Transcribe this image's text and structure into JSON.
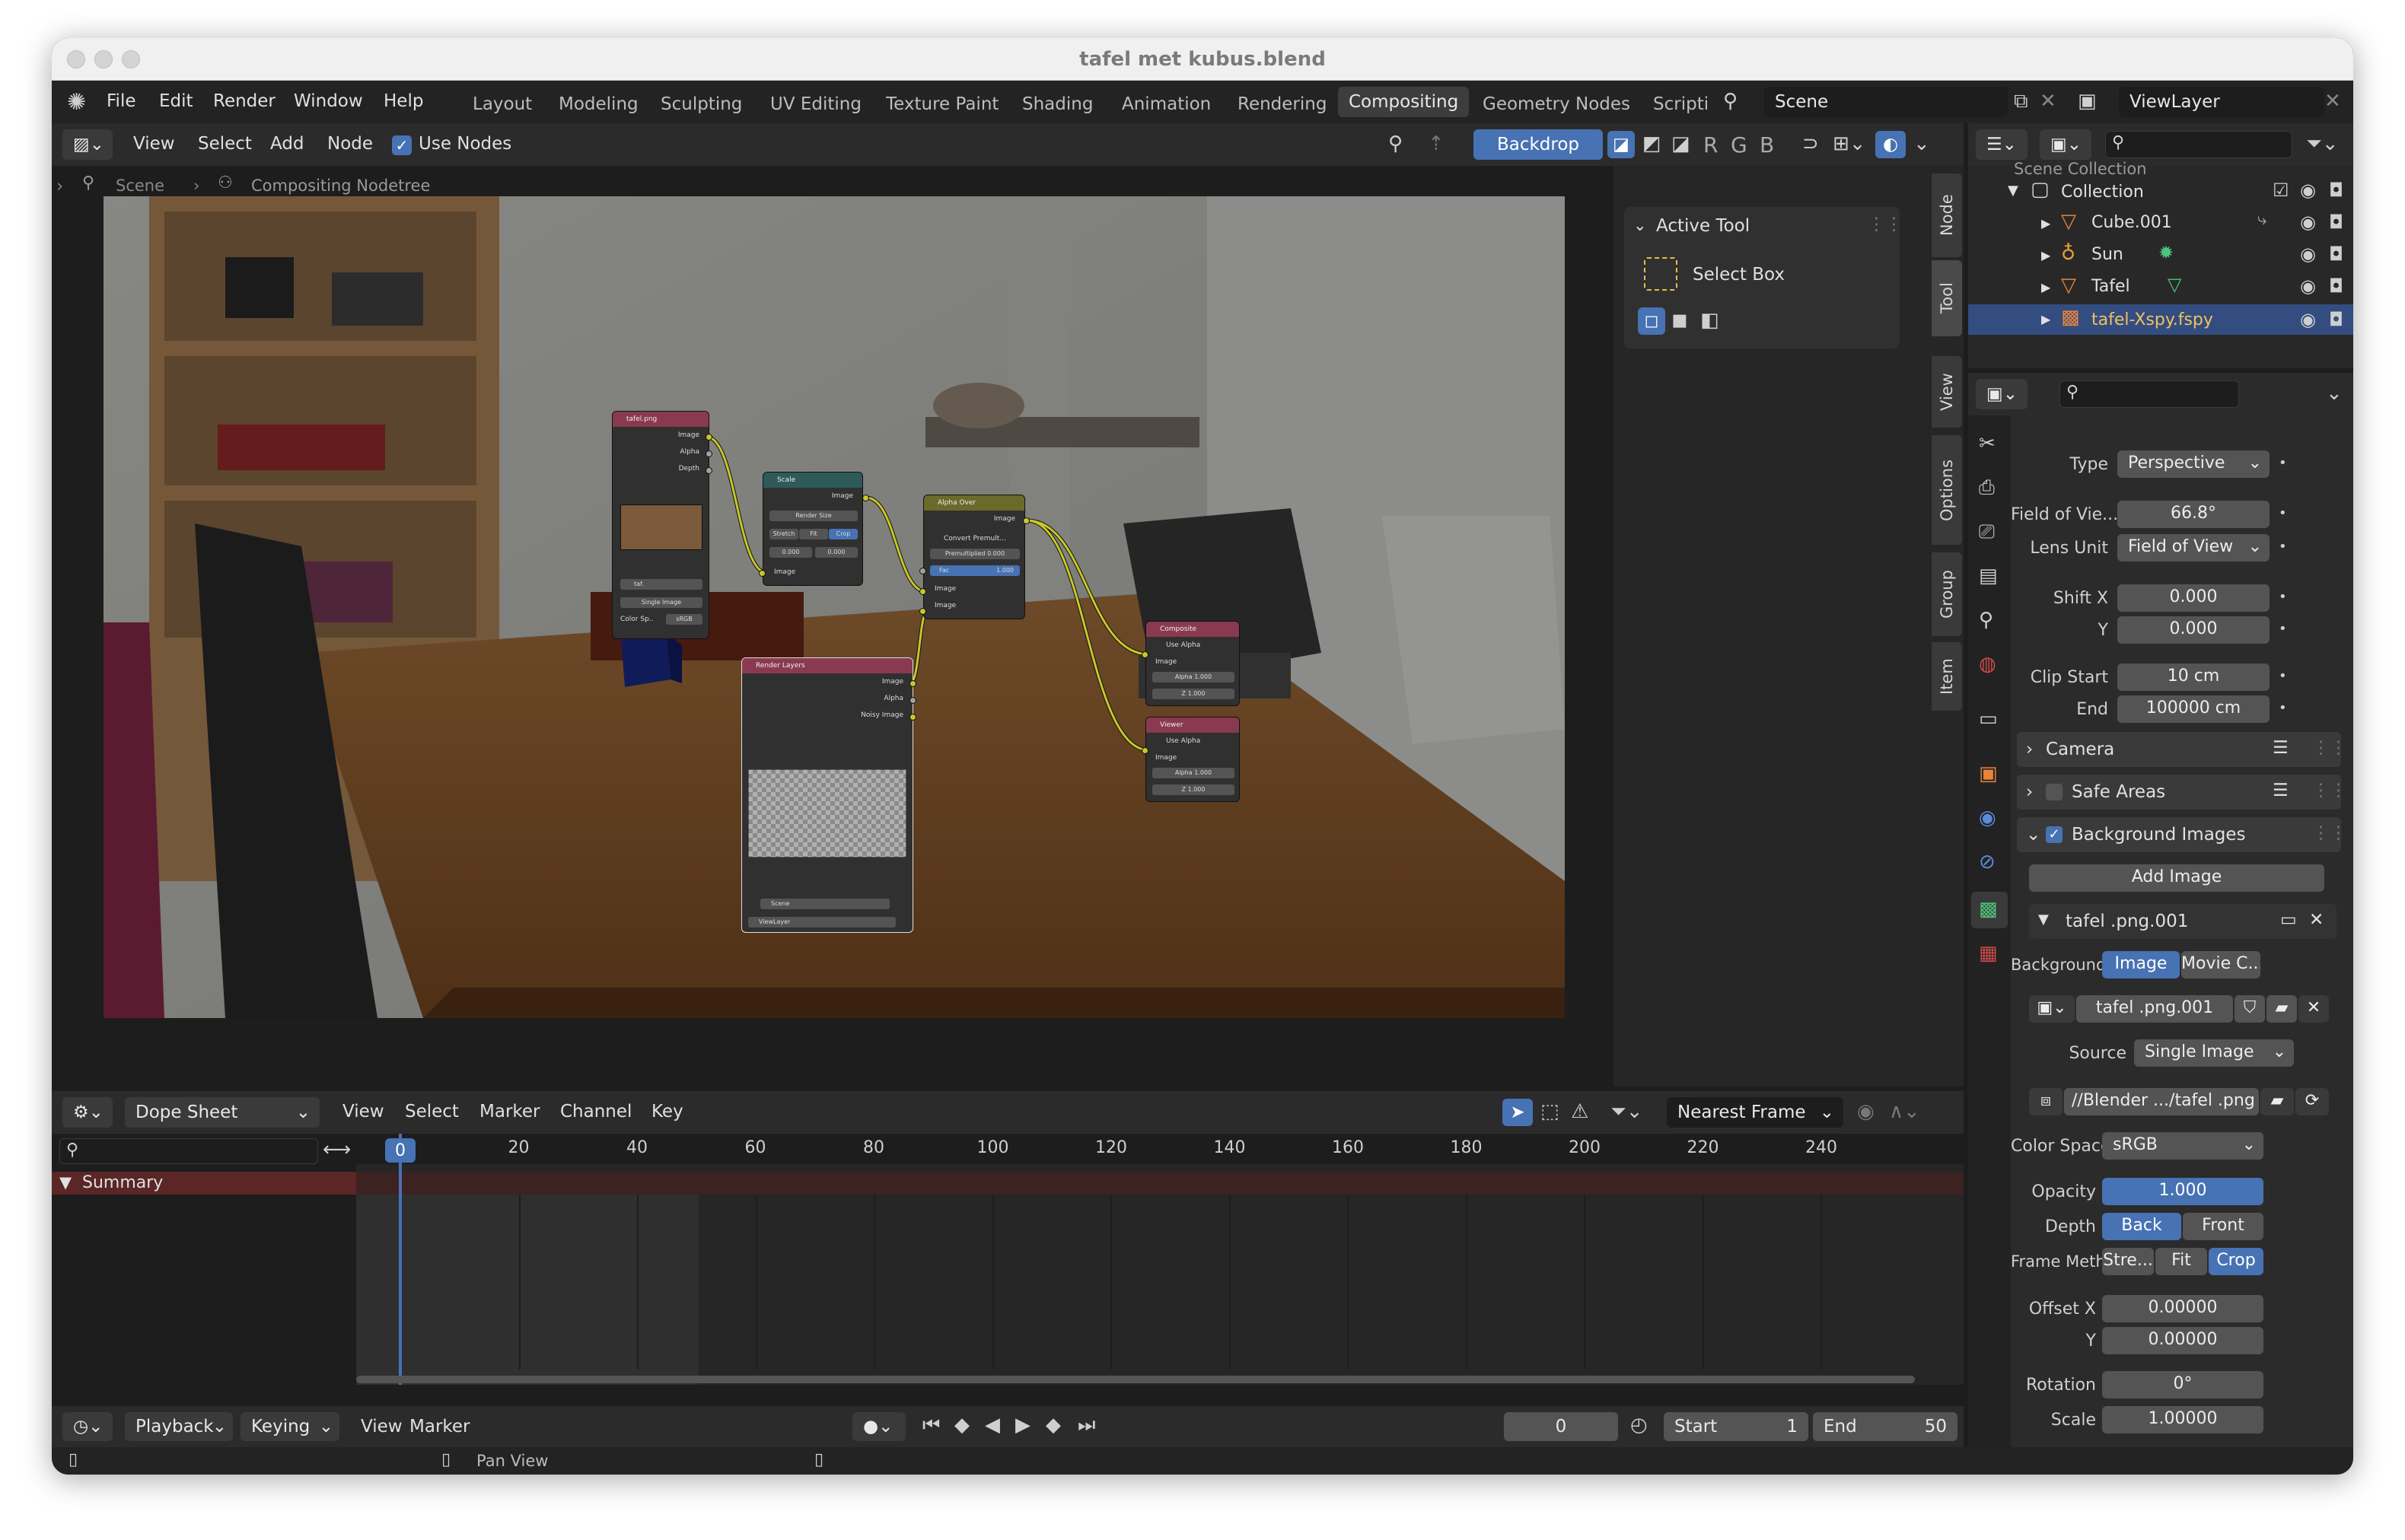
{
  "window": {
    "title": "tafel met kubus.blend"
  },
  "menu": [
    "File",
    "Edit",
    "Render",
    "Window",
    "Help"
  ],
  "workspaces": [
    "Layout",
    "Modeling",
    "Sculpting",
    "UV Editing",
    "Texture Paint",
    "Shading",
    "Animation",
    "Rendering",
    "Compositing",
    "Geometry Nodes",
    "Scripti"
  ],
  "active_workspace": "Compositing",
  "scene": {
    "name": "Scene"
  },
  "viewlayer": {
    "name": "ViewLayer"
  },
  "node_header": {
    "view": "View",
    "select": "Select",
    "add": "Add",
    "node": "Node",
    "use_nodes": "Use Nodes",
    "backdrop": "Backdrop",
    "channels": [
      "R",
      "G",
      "B"
    ]
  },
  "breadcrumb": {
    "scene": "Scene",
    "tree": "Compositing Nodetree"
  },
  "nodes": {
    "image": {
      "title": "tafel.png",
      "outputs": [
        "Image",
        "Alpha",
        "Depth"
      ],
      "file": "taf.",
      "source": "Single Image",
      "colorspace_label": "Color Sp..",
      "colorspace": "sRGB"
    },
    "scale": {
      "title": "Scale",
      "output": "Image",
      "mode": "Render Size",
      "buttons": [
        "Stretch",
        "Fit",
        "Crop"
      ],
      "x": "0.000",
      "y": "0.000",
      "input": "Image"
    },
    "alphaover": {
      "title": "Alpha Over",
      "output": "Image",
      "convert": "Convert Premult...",
      "premult": "Premultiplied 0.000",
      "fac": "Fac",
      "fac_val": "1.000",
      "in1": "Image",
      "in2": "Image"
    },
    "renderlayers": {
      "title": "Render Layers",
      "outputs": [
        "Image",
        "Alpha",
        "Noisy Image"
      ],
      "scene": "Scene",
      "layer": "ViewLayer"
    },
    "composite": {
      "title": "Composite",
      "use_alpha": "Use Alpha",
      "in": "Image",
      "alpha": "Alpha",
      "alpha_val": "1.000",
      "z": "Z",
      "z_val": "1.000"
    },
    "viewer": {
      "title": "Viewer",
      "use_alpha": "Use Alpha",
      "in": "Image",
      "alpha": "Alpha",
      "alpha_val": "1.000",
      "z": "Z",
      "z_val": "1.000"
    }
  },
  "sidebar_tabs": [
    "Node",
    "Tool",
    "View",
    "Options",
    "Group",
    "Item"
  ],
  "active_tool": {
    "header": "Active Tool",
    "tool": "Select Box"
  },
  "outliner": {
    "root": "Scene Collection",
    "collection": "Collection",
    "items": [
      {
        "name": "Cube.001",
        "icon": "mesh-triangle-icon"
      },
      {
        "name": "Sun",
        "icon": "light-icon"
      },
      {
        "name": "Tafel",
        "icon": "mesh-triangle-icon"
      },
      {
        "name": "tafel-Xspy.fspy",
        "icon": "camera-icon",
        "selected": true
      }
    ]
  },
  "properties": {
    "type_label": "Type",
    "type": "Perspective",
    "fov_label": "Field of Vie...",
    "fov": "66.8°",
    "lens_unit_label": "Lens Unit",
    "lens_unit": "Field of View",
    "shift_x_label": "Shift X",
    "shift_x": "0.000",
    "shift_y_label": "Y",
    "shift_y": "0.000",
    "clip_start_label": "Clip Start",
    "clip_start": "10 cm",
    "clip_end_label": "End",
    "clip_end": "100000 cm",
    "camera_panel": "Camera",
    "safe_areas_panel": "Safe Areas",
    "bg_images_panel": "Background Images",
    "add_image": "Add Image",
    "bg_item": "tafel .png.001",
    "bg_source_label": "Background...",
    "bg_source_opts": [
      "Image",
      "Movie C..."
    ],
    "image_name": "tafel .png.001",
    "source_label": "Source",
    "source": "Single Image",
    "path": "//Blender .../tafel .png",
    "colorspace_label": "Color Space",
    "colorspace": "sRGB",
    "opacity_label": "Opacity",
    "opacity": "1.000",
    "depth_label": "Depth",
    "depth_opts": [
      "Back",
      "Front"
    ],
    "frame_label": "Frame Meth...",
    "frame_opts": [
      "Stre...",
      "Fit",
      "Crop"
    ],
    "offset_x_label": "Offset X",
    "offset_x": "0.00000",
    "offset_y_label": "Y",
    "offset_y": "0.00000",
    "rotation_label": "Rotation",
    "rotation": "0°",
    "scale_label": "Scale",
    "scale": "1.00000"
  },
  "dopesheet": {
    "mode": "Dope Sheet",
    "menu": [
      "View",
      "Select",
      "Marker",
      "Channel",
      "Key"
    ],
    "snap": "Nearest Frame",
    "summary": "Summary",
    "ruler": [
      "0",
      "20",
      "40",
      "60",
      "80",
      "100",
      "120",
      "140",
      "160",
      "180",
      "200",
      "220",
      "240"
    ]
  },
  "timeline": {
    "menu": [
      "Playback",
      "Keying",
      "View",
      "Marker"
    ],
    "current_frame": "0",
    "start_label": "Start",
    "start": "1",
    "end_label": "End",
    "end": "50"
  },
  "statusbar": {
    "pan": "Pan View"
  }
}
